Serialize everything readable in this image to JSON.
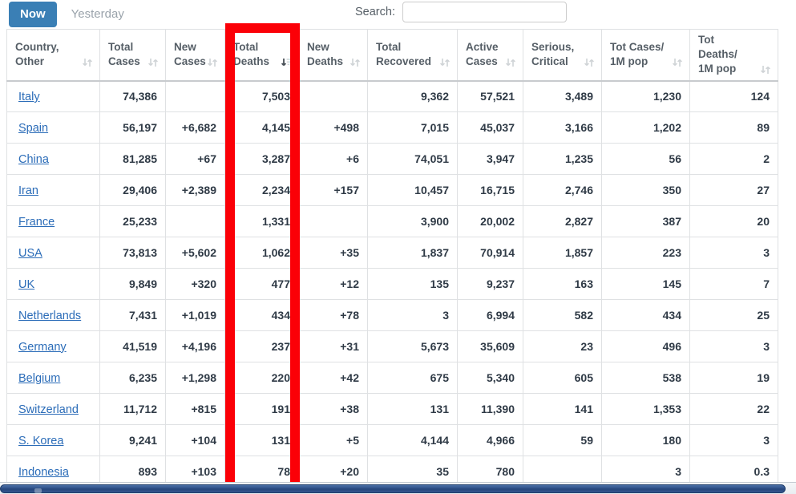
{
  "toolbar": {
    "tabs": [
      {
        "label": "Now",
        "active": true
      },
      {
        "label": "Yesterday",
        "active": false
      }
    ],
    "search_label": "Search:",
    "search_value": "",
    "search_placeholder": ""
  },
  "highlight": {
    "color": "#fb0007",
    "target_column": "Total Deaths"
  },
  "table": {
    "columns": [
      {
        "key": "country",
        "line1": "Country,",
        "line2": "Other",
        "sort": "none"
      },
      {
        "key": "total_cases",
        "line1": "Total",
        "line2": "Cases",
        "sort": "none"
      },
      {
        "key": "new_cases",
        "line1": "New",
        "line2": "Cases",
        "sort": "none"
      },
      {
        "key": "total_deaths",
        "line1": "Total",
        "line2": "Deaths",
        "sort": "desc"
      },
      {
        "key": "new_deaths",
        "line1": "New",
        "line2": "Deaths",
        "sort": "none"
      },
      {
        "key": "total_recov",
        "line1": "Total",
        "line2": "Recovered",
        "sort": "none"
      },
      {
        "key": "active_cases",
        "line1": "Active",
        "line2": "Cases",
        "sort": "none"
      },
      {
        "key": "serious",
        "line1": "Serious,",
        "line2": "Critical",
        "sort": "none"
      },
      {
        "key": "cases_1m",
        "line1": "Tot Cases/",
        "line2": "1M pop",
        "sort": "none"
      },
      {
        "key": "deaths_1m",
        "line1": "Tot Deaths/",
        "line2": "1M pop",
        "sort": "none"
      }
    ],
    "rows": [
      {
        "country": "Italy",
        "total_cases": "74,386",
        "new_cases": "",
        "total_deaths": "7,503",
        "new_deaths": "",
        "total_recov": "9,362",
        "active_cases": "57,521",
        "serious": "3,489",
        "cases_1m": "1,230",
        "deaths_1m": "124"
      },
      {
        "country": "Spain",
        "total_cases": "56,197",
        "new_cases": "+6,682",
        "total_deaths": "4,145",
        "new_deaths": "+498",
        "total_recov": "7,015",
        "active_cases": "45,037",
        "serious": "3,166",
        "cases_1m": "1,202",
        "deaths_1m": "89"
      },
      {
        "country": "China",
        "total_cases": "81,285",
        "new_cases": "+67",
        "total_deaths": "3,287",
        "new_deaths": "+6",
        "total_recov": "74,051",
        "active_cases": "3,947",
        "serious": "1,235",
        "cases_1m": "56",
        "deaths_1m": "2"
      },
      {
        "country": "Iran",
        "total_cases": "29,406",
        "new_cases": "+2,389",
        "total_deaths": "2,234",
        "new_deaths": "+157",
        "total_recov": "10,457",
        "active_cases": "16,715",
        "serious": "2,746",
        "cases_1m": "350",
        "deaths_1m": "27"
      },
      {
        "country": "France",
        "total_cases": "25,233",
        "new_cases": "",
        "total_deaths": "1,331",
        "new_deaths": "",
        "total_recov": "3,900",
        "active_cases": "20,002",
        "serious": "2,827",
        "cases_1m": "387",
        "deaths_1m": "20"
      },
      {
        "country": "USA",
        "total_cases": "73,813",
        "new_cases": "+5,602",
        "total_deaths": "1,062",
        "new_deaths": "+35",
        "total_recov": "1,837",
        "active_cases": "70,914",
        "serious": "1,857",
        "cases_1m": "223",
        "deaths_1m": "3"
      },
      {
        "country": "UK",
        "total_cases": "9,849",
        "new_cases": "+320",
        "total_deaths": "477",
        "new_deaths": "+12",
        "total_recov": "135",
        "active_cases": "9,237",
        "serious": "163",
        "cases_1m": "145",
        "deaths_1m": "7"
      },
      {
        "country": "Netherlands",
        "total_cases": "7,431",
        "new_cases": "+1,019",
        "total_deaths": "434",
        "new_deaths": "+78",
        "total_recov": "3",
        "active_cases": "6,994",
        "serious": "582",
        "cases_1m": "434",
        "deaths_1m": "25"
      },
      {
        "country": "Germany",
        "total_cases": "41,519",
        "new_cases": "+4,196",
        "total_deaths": "237",
        "new_deaths": "+31",
        "total_recov": "5,673",
        "active_cases": "35,609",
        "serious": "23",
        "cases_1m": "496",
        "deaths_1m": "3"
      },
      {
        "country": "Belgium",
        "total_cases": "6,235",
        "new_cases": "+1,298",
        "total_deaths": "220",
        "new_deaths": "+42",
        "total_recov": "675",
        "active_cases": "5,340",
        "serious": "605",
        "cases_1m": "538",
        "deaths_1m": "19"
      },
      {
        "country": "Switzerland",
        "total_cases": "11,712",
        "new_cases": "+815",
        "total_deaths": "191",
        "new_deaths": "+38",
        "total_recov": "131",
        "active_cases": "11,390",
        "serious": "141",
        "cases_1m": "1,353",
        "deaths_1m": "22"
      },
      {
        "country": "S. Korea",
        "total_cases": "9,241",
        "new_cases": "+104",
        "total_deaths": "131",
        "new_deaths": "+5",
        "total_recov": "4,144",
        "active_cases": "4,966",
        "serious": "59",
        "cases_1m": "180",
        "deaths_1m": "3"
      },
      {
        "country": "Indonesia",
        "total_cases": "893",
        "new_cases": "+103",
        "total_deaths": "78",
        "new_deaths": "+20",
        "total_recov": "35",
        "active_cases": "780",
        "serious": "",
        "cases_1m": "3",
        "deaths_1m": "0.3"
      }
    ]
  },
  "scrollbar": {
    "orientation": "horizontal"
  }
}
